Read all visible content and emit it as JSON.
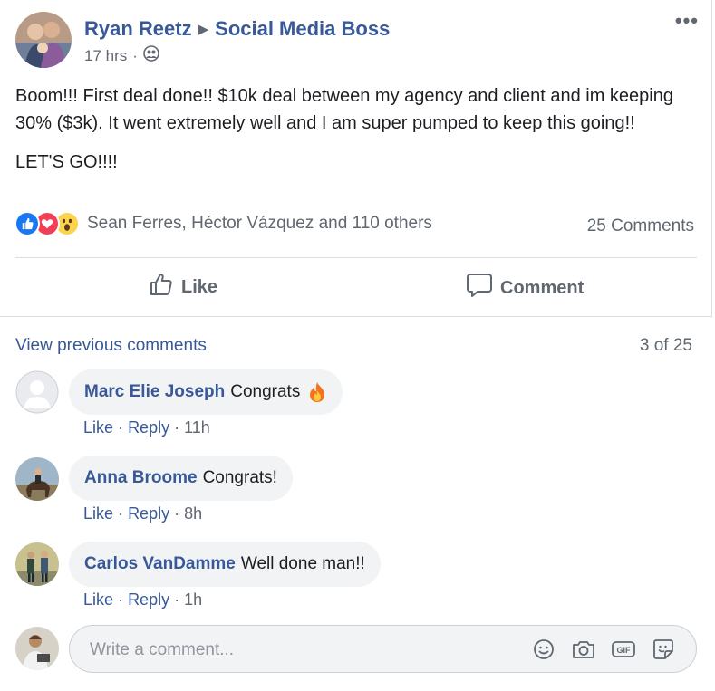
{
  "post": {
    "author": "Ryan Reetz",
    "group": "Social Media Boss",
    "time": "17 hrs",
    "separator": "·",
    "body_line1": "Boom!!! First deal done!! $10k deal between my agency and client and im keeping 30% ($3k). It went extremely well and I am super pumped to keep this going!!",
    "body_line2": "LET'S GO!!!!",
    "reaction_names": "Sean Ferres, Héctor Vázquez and 110 others",
    "comment_count": "25 Comments"
  },
  "actions": {
    "like_label": "Like",
    "comment_label": "Comment"
  },
  "comments_section": {
    "view_previous": "View previous comments",
    "count_label": "3 of 25",
    "items": [
      {
        "author": "Marc Elie Joseph",
        "text": "Congrats",
        "like": "Like",
        "reply": "Reply",
        "time": "11h"
      },
      {
        "author": "Anna Broome",
        "text": "Congrats!",
        "like": "Like",
        "reply": "Reply",
        "time": "8h"
      },
      {
        "author": "Carlos VanDamme",
        "text": "Well done man!!",
        "like": "Like",
        "reply": "Reply",
        "time": "1h"
      }
    ],
    "dot": "·",
    "write_placeholder": "Write a comment..."
  },
  "colors": {
    "link_blue": "#385898",
    "secondary_text": "#606770",
    "like_blue": "#1877f2",
    "love_red": "#f33e58",
    "bubble_bg": "#f2f3f5"
  },
  "icons": {
    "audience": "friends-icon",
    "more": "more-options-icon",
    "like": "thumbs-up-icon",
    "comment": "comment-bubble-icon",
    "fire": "fire-emoji-icon",
    "emoji": "emoji-icon",
    "camera": "camera-icon",
    "gif": "gif-icon",
    "sticker": "sticker-icon"
  }
}
